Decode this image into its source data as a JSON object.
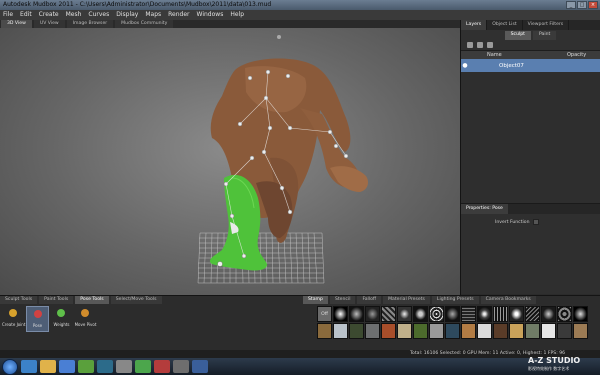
{
  "window": {
    "title": "Autodesk Mudbox 2011 - C:\\Users\\Administrator\\Documents\\Mudbox\\2011\\data\\013.mud"
  },
  "menu": [
    "File",
    "Edit",
    "Create",
    "Mesh",
    "Curves",
    "Display",
    "Maps",
    "Render",
    "Windows",
    "Help"
  ],
  "viewport_tabs": [
    "3D View",
    "UV View",
    "Image Browser",
    "Mudbox Community"
  ],
  "right_panel": {
    "tabs": [
      "Layers",
      "Object List",
      "Viewport Filters"
    ],
    "sub_tabs": [
      "Sculpt",
      "Paint"
    ],
    "layer_columns": {
      "name": "Name",
      "opacity": "Opacity"
    },
    "layer_row": "Object07",
    "properties_tab": "Properties: Pose",
    "invert_label": "Invert Function"
  },
  "tray": {
    "tabs": [
      "Sculpt Tools",
      "Paint Tools",
      "Pose Tools",
      "Select/Move Tools"
    ],
    "tools": [
      {
        "label": "Create Joint",
        "color": "#d7a12c"
      },
      {
        "label": "Pose",
        "color": "#d04242"
      },
      {
        "label": "Weights",
        "color": "#5fbf4a"
      },
      {
        "label": "Move Pivot",
        "color": "#d08c2c"
      }
    ],
    "stamp_tabs": [
      "Stamp",
      "Stencil",
      "Falloff",
      "Material Presets",
      "Lighting Presets",
      "Camera Bookmarks"
    ],
    "off_label": "Off"
  },
  "status": "Total: 16106  Selected: 0  GPU Mem: 11  Active: 0, Highest: 1  FPS: 96",
  "watermark": {
    "main": "A-Z STUDIO",
    "sub": "影视特效制作  数字艺术"
  }
}
